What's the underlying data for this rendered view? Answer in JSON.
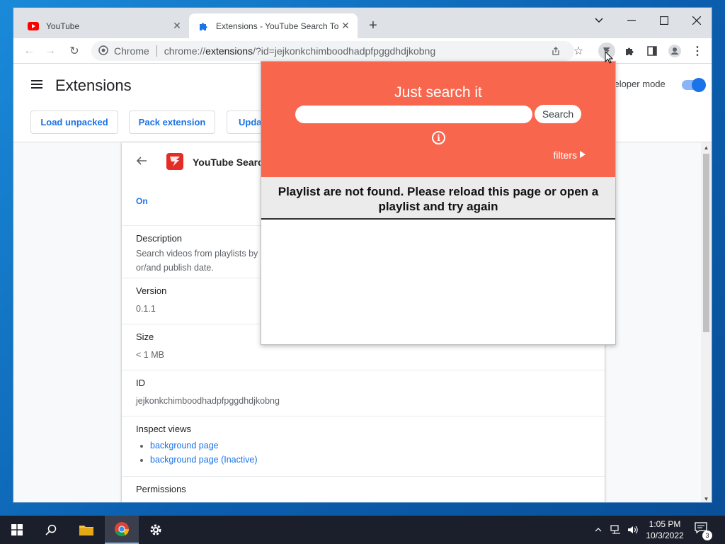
{
  "browser": {
    "tabs": [
      {
        "title": "YouTube"
      },
      {
        "title": "Extensions - YouTube Search Tor"
      }
    ],
    "omnibox": {
      "scheme_label": "Chrome",
      "url_host": "chrome://",
      "url_path": "extensions",
      "url_rest": "/?id=jejkonkchimboodhadpfpggdhdjkobng"
    }
  },
  "extensions_page": {
    "title": "Extensions",
    "buttons": [
      "Load unpacked",
      "Pack extension",
      "Upda"
    ],
    "developer_mode_label": "veloper mode",
    "developer_mode_on": true
  },
  "detail": {
    "name": "YouTube Search",
    "status": "On",
    "description_label": "Description",
    "description_value_1": "Search videos from playlists by",
    "description_value_2": "or/and publish date.",
    "version_label": "Version",
    "version_value": "0.1.1",
    "size_label": "Size",
    "size_value": "< 1 MB",
    "id_label": "ID",
    "id_value": "jejkonkchimboodhadpfpggdhdjkobng",
    "inspect_label": "Inspect views",
    "inspect_links": [
      "background page",
      "background page (Inactive)"
    ],
    "permissions_label": "Permissions"
  },
  "popup": {
    "title": "Just search it",
    "search_placeholder": "",
    "search_button": "Search",
    "info_glyph": "i",
    "filters_label": "filters",
    "message": "Playlist are not found. Please reload this page or open a playlist and try again"
  },
  "taskbar": {
    "time": "1:05 PM",
    "date": "10/3/2022",
    "notification_count": "3"
  },
  "colors": {
    "popup_accent": "#f9664e",
    "chrome_blue": "#1a73e8"
  }
}
